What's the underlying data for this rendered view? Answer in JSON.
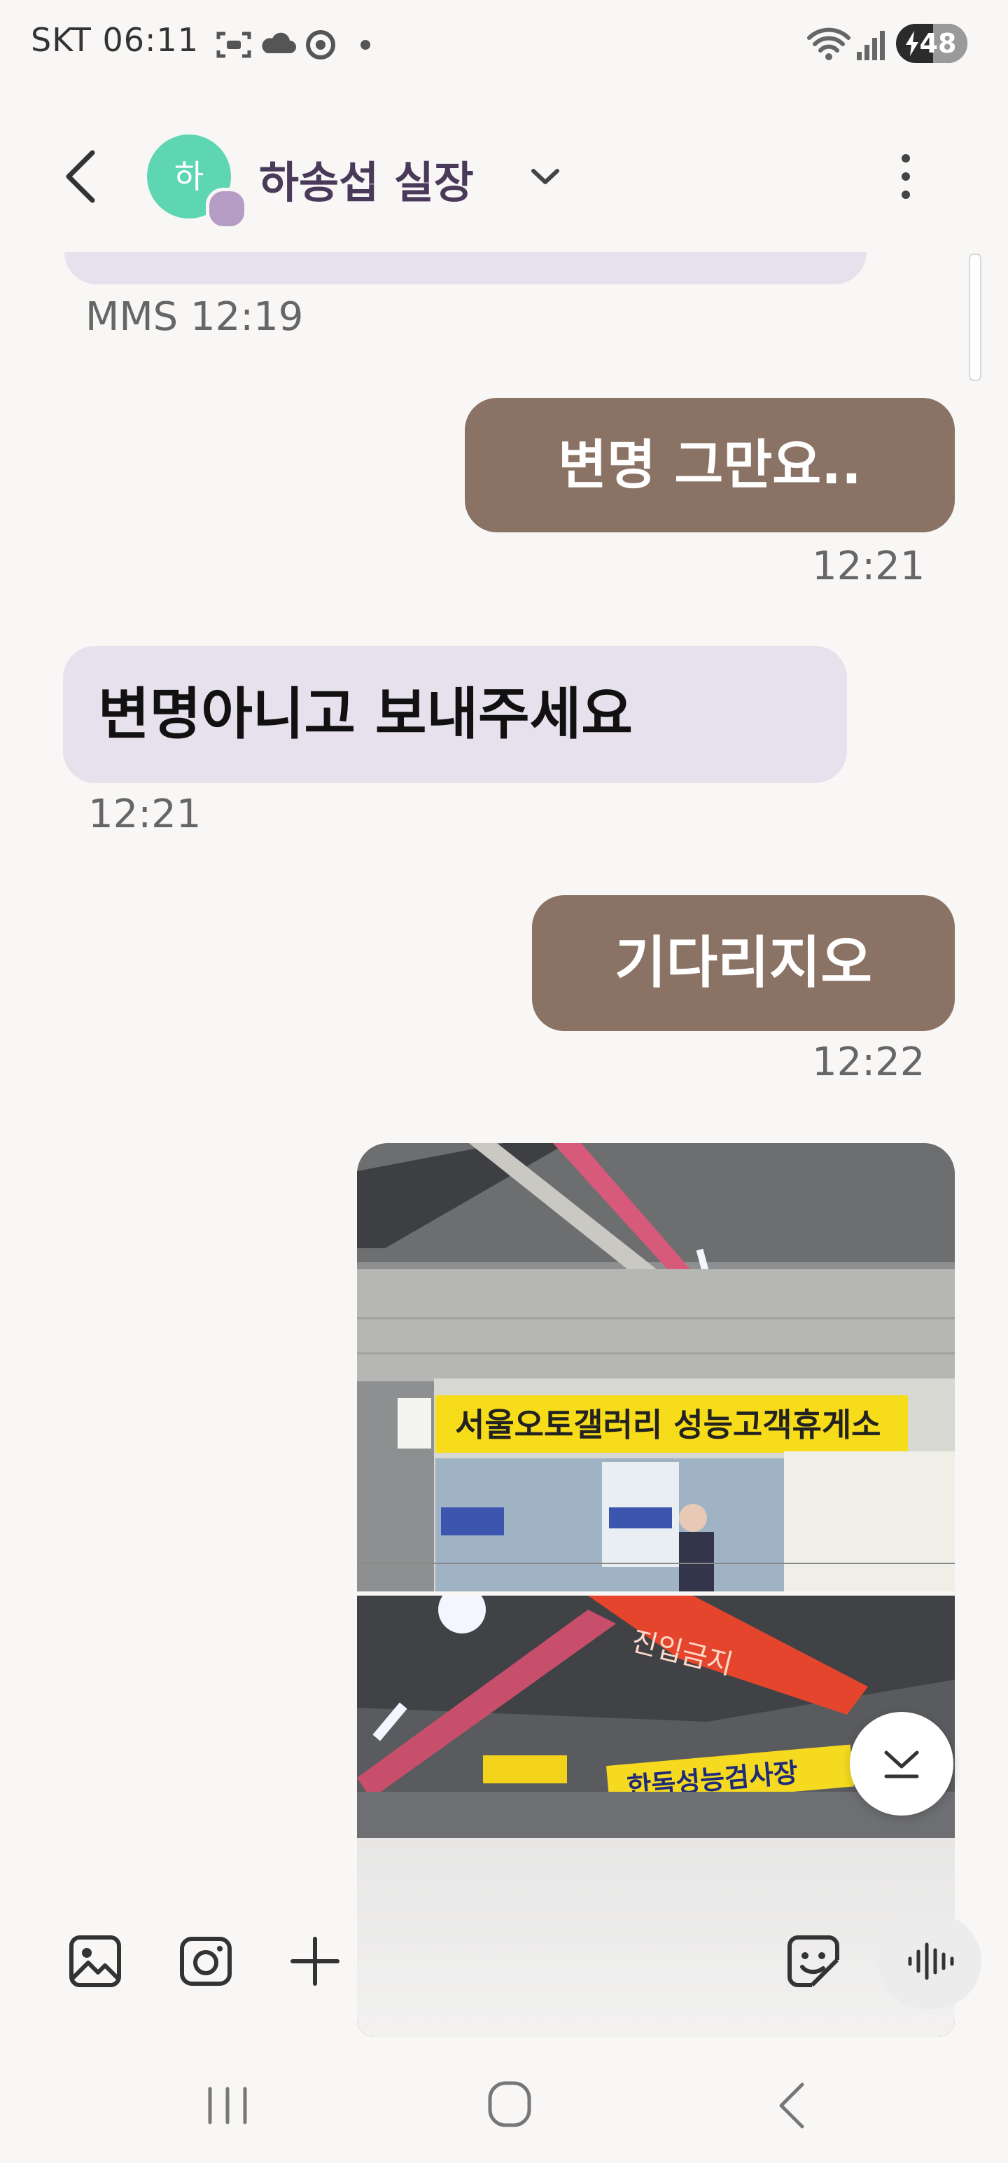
{
  "status_bar": {
    "carrier_time": "SKT 06:11",
    "battery": "48",
    "icons": [
      "screenshot-icon",
      "cloud-icon",
      "chrome-icon",
      "dot-icon",
      "wifi-icon",
      "signal-icon",
      "battery-icon"
    ]
  },
  "header": {
    "contact_name": "하송섭 실장",
    "avatar_initial": "하",
    "back_icon": "back-arrow-icon",
    "dropdown_icon": "chevron-down-icon",
    "menu_icon": "more-vertical-icon"
  },
  "messages": [
    {
      "direction": "incoming",
      "type": "mms",
      "meta": "MMS 12:19"
    },
    {
      "direction": "outgoing",
      "text": "변명 그만요..",
      "time": "12:21"
    },
    {
      "direction": "incoming",
      "text": "변명아니고 보내주세요",
      "time": "12:21"
    },
    {
      "direction": "outgoing",
      "text": "기다리지오",
      "time": "12:22"
    },
    {
      "direction": "outgoing",
      "type": "images",
      "signs": [
        "서울오토갤러리 성능고객휴게소",
        "진입금지",
        "한독성능검사장"
      ]
    }
  ],
  "composer": {
    "icons": [
      "gallery-icon",
      "camera-icon",
      "plus-icon",
      "emoji-sticker-icon",
      "voice-record-icon"
    ]
  },
  "colors": {
    "background": "#f8f7f6",
    "incoming_bubble": "#e6e1ec",
    "outgoing_bubble": "#8a7264",
    "avatar": "#5fd6b2",
    "name": "#4a3a5a"
  },
  "nav_bar": {
    "icons": [
      "recent-apps-icon",
      "home-icon",
      "back-icon"
    ]
  }
}
